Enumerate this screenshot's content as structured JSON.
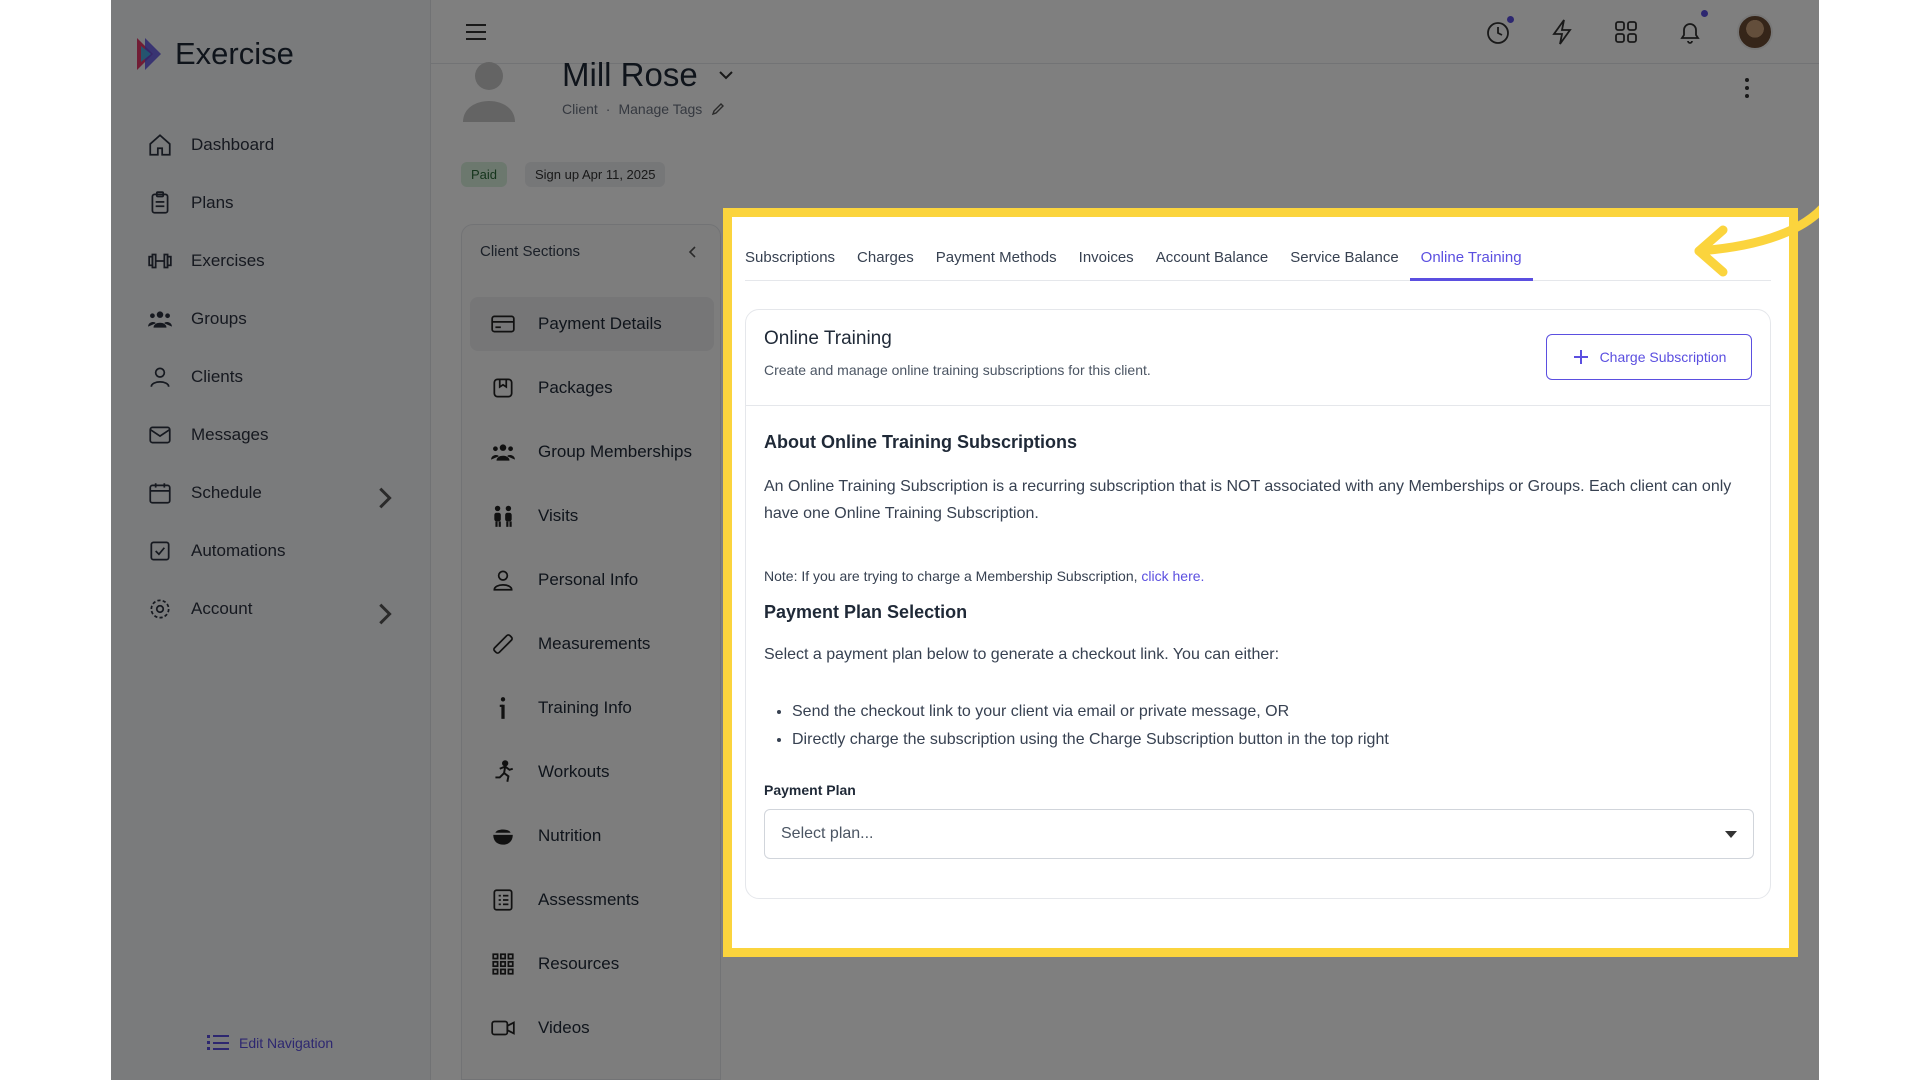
{
  "app": {
    "name": "Exercise"
  },
  "sidebar": {
    "items": [
      {
        "label": "Dashboard",
        "icon": "home-icon"
      },
      {
        "label": "Plans",
        "icon": "clipboard-icon"
      },
      {
        "label": "Exercises",
        "icon": "dumbbell-icon"
      },
      {
        "label": "Groups",
        "icon": "users-icon"
      },
      {
        "label": "Clients",
        "icon": "user-icon"
      },
      {
        "label": "Messages",
        "icon": "mail-icon"
      },
      {
        "label": "Schedule",
        "icon": "calendar-icon",
        "has_submenu": true
      },
      {
        "label": "Automations",
        "icon": "checkbox-icon"
      },
      {
        "label": "Account",
        "icon": "gear-icon",
        "has_submenu": true
      }
    ],
    "edit_navigation": "Edit Navigation"
  },
  "topbar": {
    "icons": [
      "menu-icon",
      "timer-icon",
      "bolt-icon",
      "apps-grid-icon",
      "bell-icon",
      "avatar"
    ]
  },
  "client": {
    "name": "Mill Rose",
    "role": "Client",
    "separator": "·",
    "manage_tags": "Manage Tags",
    "badge_paid": "Paid",
    "badge_signup": "Sign up Apr 11, 2025"
  },
  "sections": {
    "title": "Client Sections",
    "items": [
      {
        "label": "Payment Details",
        "icon": "credit-card-icon",
        "active": true
      },
      {
        "label": "Packages",
        "icon": "package-icon"
      },
      {
        "label": "Group Memberships",
        "icon": "group-icon"
      },
      {
        "label": "Visits",
        "icon": "people-icon"
      },
      {
        "label": "Personal Info",
        "icon": "person-icon"
      },
      {
        "label": "Measurements",
        "icon": "ruler-icon"
      },
      {
        "label": "Training Info",
        "icon": "info-icon"
      },
      {
        "label": "Workouts",
        "icon": "running-icon"
      },
      {
        "label": "Nutrition",
        "icon": "bowl-icon"
      },
      {
        "label": "Assessments",
        "icon": "checklist-icon"
      },
      {
        "label": "Resources",
        "icon": "grid-icon"
      },
      {
        "label": "Videos",
        "icon": "video-icon"
      }
    ]
  },
  "tabs": [
    {
      "label": "Subscriptions"
    },
    {
      "label": "Charges"
    },
    {
      "label": "Payment Methods"
    },
    {
      "label": "Invoices"
    },
    {
      "label": "Account Balance"
    },
    {
      "label": "Service Balance"
    },
    {
      "label": "Online Training",
      "active": true
    }
  ],
  "card": {
    "title": "Online Training",
    "subtitle": "Create and manage online training subscriptions for this client.",
    "charge_button": "Charge Subscription",
    "about_heading": "About Online Training Subscriptions",
    "about_text": "An Online Training Subscription is a recurring subscription that is NOT associated with any Memberships or Groups. Each client can only have one Online Training Subscription.",
    "note_text": "Note: If you are trying to charge a Membership Subscription,",
    "note_link": "click here.",
    "plan_heading": "Payment Plan Selection",
    "plan_text": "Select a payment plan below to generate a checkout link. You can either:",
    "bullets": [
      "Send the checkout link to your client via email or private message, OR",
      "Directly charge the subscription using the Charge Subscription button in the top right"
    ],
    "plan_label": "Payment Plan",
    "plan_placeholder": "Select plan..."
  },
  "colors": {
    "accent": "#5b4fe0",
    "highlight": "#fbd43d",
    "paid_badge_bg": "#d8f1dc"
  }
}
